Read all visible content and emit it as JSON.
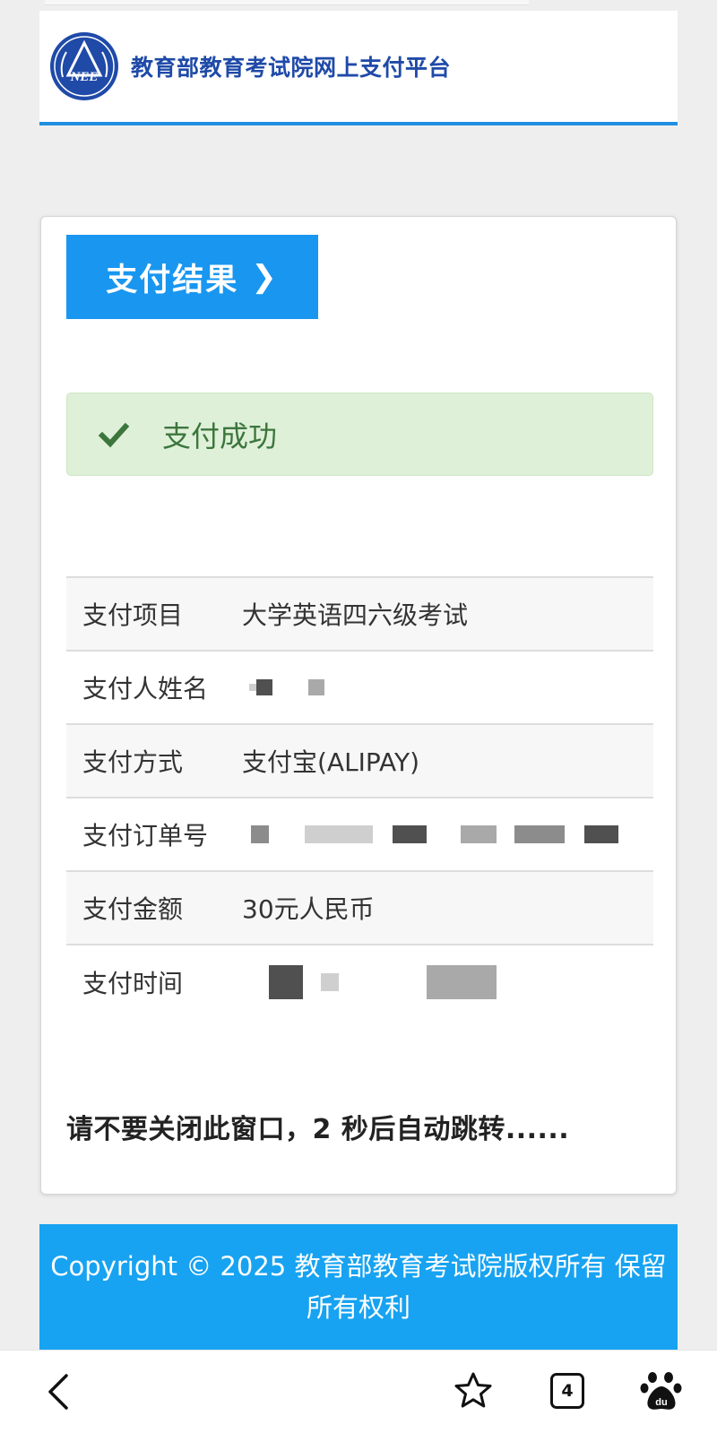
{
  "header": {
    "logo_text": "NEE",
    "site_title": "教育部教育考试院网上支付平台"
  },
  "result_tab": {
    "label": "支付结果",
    "chevron": "❯"
  },
  "status": {
    "icon": "check-icon",
    "text": "支付成功",
    "color": "#3c763d",
    "background": "#dff0d8"
  },
  "details": [
    {
      "label": "支付项目",
      "value": "大学英语四六级考试"
    },
    {
      "label": "支付人姓名",
      "value": ""
    },
    {
      "label": "支付方式",
      "value": "支付宝(ALIPAY)"
    },
    {
      "label": "支付订单号",
      "value": ""
    },
    {
      "label": "支付金额",
      "value": "30元人民币"
    },
    {
      "label": "支付时间",
      "value": ""
    }
  ],
  "notice": "请不要关闭此窗口，2 秒后自动跳转......",
  "footer": {
    "copyright": "Copyright © 2025 教育部教育考试院版权所有 保留所有权利"
  },
  "browser_bar": {
    "tab_count": "4",
    "icons": [
      "back-icon",
      "bookmark-star-icon",
      "tabs-icon",
      "baidu-paw-icon"
    ]
  },
  "colors": {
    "accent_blue": "#1996f0",
    "footer_blue": "#17a3f1",
    "header_rule": "#1f8fe0",
    "title_blue": "#1f4aa8"
  }
}
